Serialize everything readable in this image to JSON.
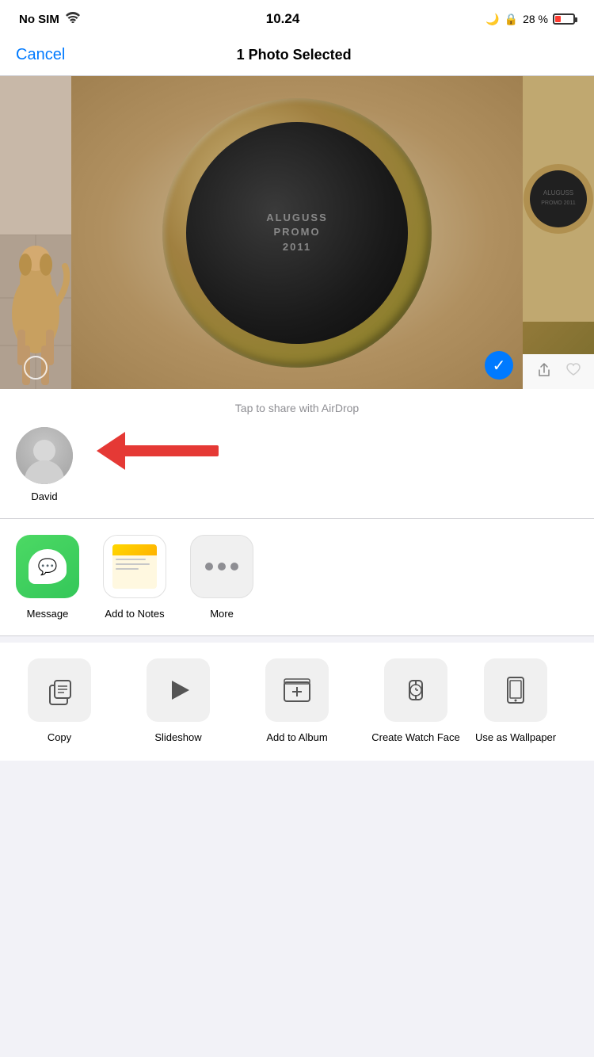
{
  "statusBar": {
    "carrier": "No SIM",
    "time": "10.24",
    "batteryPercent": "28 %",
    "moonIcon": "🌙",
    "lockIcon": "🔒"
  },
  "navBar": {
    "cancelLabel": "Cancel",
    "title": "1 Photo Selected"
  },
  "airdrop": {
    "label": "Tap to share with AirDrop",
    "contact": {
      "name": "David"
    }
  },
  "apps": [
    {
      "id": "message",
      "label": "Message",
      "type": "messages"
    },
    {
      "id": "add-to-notes",
      "label": "Add to Notes",
      "type": "notes"
    },
    {
      "id": "more",
      "label": "More",
      "type": "more"
    }
  ],
  "actions": [
    {
      "id": "copy",
      "label": "Copy",
      "icon": "copy"
    },
    {
      "id": "slideshow",
      "label": "Slideshow",
      "icon": "slideshow"
    },
    {
      "id": "add-to-album",
      "label": "Add to Album",
      "icon": "album"
    },
    {
      "id": "create-watch-face",
      "label": "Create Watch Face",
      "icon": "watch"
    },
    {
      "id": "use-as-wallpaper",
      "label": "Use as Wallpaper",
      "icon": "wallpaper"
    }
  ]
}
